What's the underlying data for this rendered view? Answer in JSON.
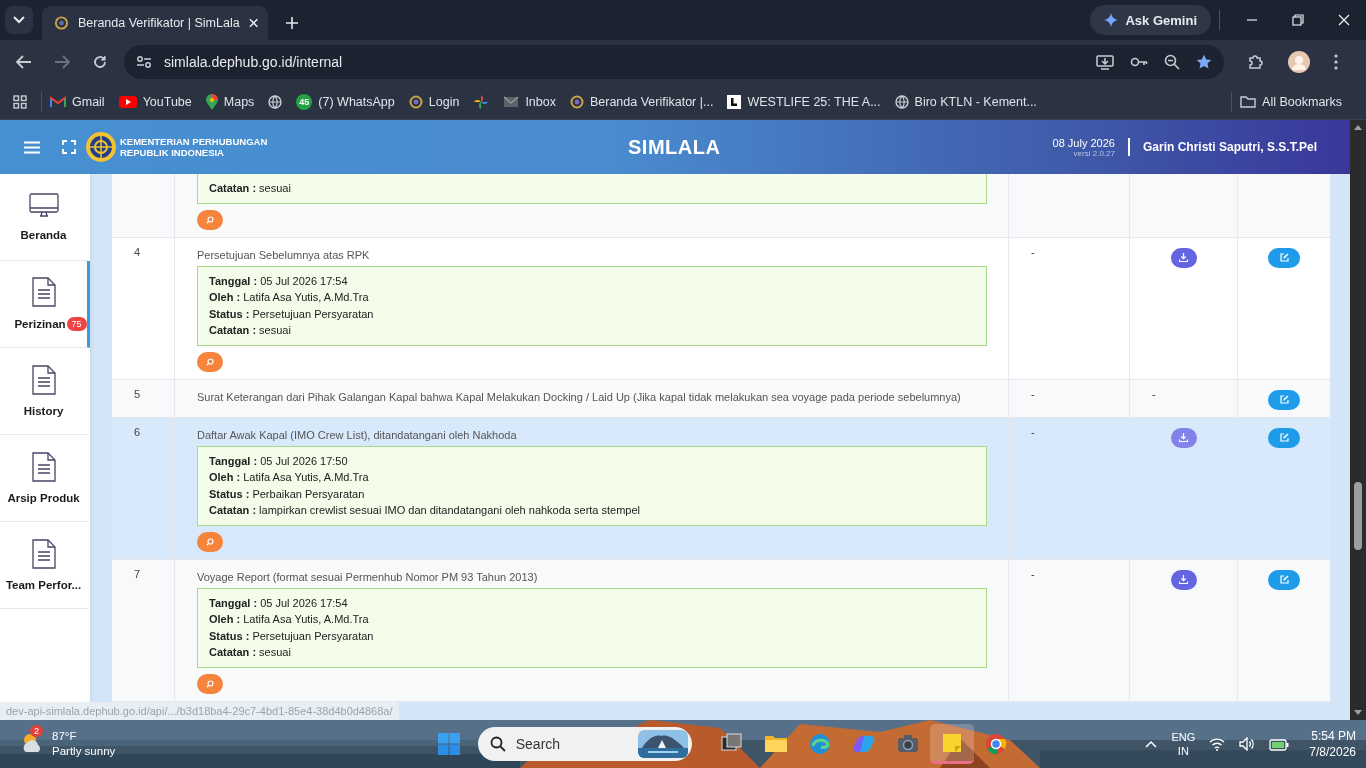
{
  "browser": {
    "tabs": [
      {
        "title": "Beranda Verifikator | SimLala",
        "selected": true
      }
    ],
    "ask_gemini": "Ask Gemini",
    "url": "simlala.dephub.go.id/internal",
    "bookmarks": [
      {
        "kind": "gmail",
        "label": "Gmail"
      },
      {
        "kind": "youtube",
        "label": "YouTube"
      },
      {
        "kind": "maps",
        "label": "Maps"
      },
      {
        "kind": "globe"
      },
      {
        "kind": "whatsapp",
        "label": "(7) WhatsApp",
        "badge": "45"
      },
      {
        "kind": "wheel",
        "label": "Login"
      },
      {
        "kind": "pinwheel"
      },
      {
        "kind": "mail",
        "label": "Inbox"
      },
      {
        "kind": "wheel",
        "label": "Beranda Verifikator |..."
      },
      {
        "kind": "square",
        "label": "WESTLIFE 25: THE A..."
      },
      {
        "kind": "globe",
        "label": "Biro KTLN - Kement..."
      }
    ],
    "all_bookmarks": "All Bookmarks"
  },
  "header": {
    "org_line1": "KEMENTERIAN PERHUBUNGAN",
    "org_line2": "REPUBLIK INDONESIA",
    "app_title": "SIMLALA",
    "date": "08 July 2026",
    "version": "versi 2.0.27",
    "user": "Garin Christi Saputri, S.S.T.Pel"
  },
  "sidebar": {
    "items": [
      {
        "kind": "monitor",
        "label": "Beranda",
        "selected": false
      },
      {
        "kind": "document",
        "label": "Perizinan",
        "selected": true,
        "badge": "75"
      },
      {
        "kind": "document",
        "label": "History",
        "selected": false
      },
      {
        "kind": "document",
        "label": "Arsip Produk",
        "selected": false
      },
      {
        "kind": "document",
        "label": "Team Perfor...",
        "selected": false
      }
    ]
  },
  "table": {
    "rows": [
      {
        "number": "",
        "title": "",
        "hovered": false,
        "remarks": [
          "**Catatan :** sesuai"
        ],
        "column_3": "",
        "column_4": {
          "kind": "none"
        },
        "edit": false
      },
      {
        "number": "4",
        "title": "Persetujuan Sebelumnya atas RPK",
        "hovered": false,
        "remarks": [
          "**Tanggal :** 05 Jul 2026 17:54",
          "**Oleh :** Latifa Asa Yutis, A.Md.Tra",
          "**Status :** Persetujuan Persyaratan",
          "**Catatan :** sesuai"
        ],
        "column_3": "-",
        "column_4": {
          "kind": "download"
        },
        "edit": true
      },
      {
        "number": "5",
        "title": "Surat Keterangan dari Pihak Galangan Kapal bahwa Kapal Melakukan Docking / Laid Up (Jika kapal tidak melakukan sea voyage pada periode sebelumnya)",
        "hovered": false,
        "remarks": [],
        "column_3": "-",
        "column_4": {
          "kind": "text",
          "text": "-"
        },
        "edit": true
      },
      {
        "number": "6",
        "title": "Daftar Awak Kapal (IMO Crew List), ditandatangani oleh Nakhoda",
        "hovered": true,
        "remarks": [
          "**Tanggal :** 05 Jul 2026 17:50",
          "**Oleh :** Latifa Asa Yutis, A.Md.Tra",
          "**Status :** Perbaikan Persyaratan",
          "**Catatan :** lampirkan crewlist sesuai IMO dan ditandatangani oleh nahkoda serta stempel"
        ],
        "column_3": "-",
        "column_4": {
          "kind": "download"
        },
        "edit": true
      },
      {
        "number": "7",
        "title": "Voyage Report (format sesuai Permenhub Nomor PM 93 Tahun 2013)",
        "hovered": false,
        "remarks": [
          "**Tanggal :** 05 Jul 2026 17:54",
          "**Oleh :** Latifa Asa Yutis, A.Md.Tra",
          "**Status :** Persetujuan Persyaratan",
          "**Catatan :** sesuai"
        ],
        "column_3": "-",
        "column_4": {
          "kind": "download"
        },
        "edit": true
      }
    ]
  },
  "status_url": "dev-api-simlala.dephub.go.id/api/.../b3d18ba4-29c7-4bd1-85e4-38d4b0d4868a/",
  "taskbar": {
    "weather": {
      "badge": "2",
      "temperature": "87°F",
      "condition": "Partly sunny"
    },
    "search_placeholder": "Search",
    "language": "ENG",
    "region": "IN",
    "time": "5:54 PM",
    "date": "7/8/2026",
    "apps": [
      {
        "selected": false
      },
      {
        "selected": false
      },
      {
        "selected": false
      },
      {
        "selected": false
      },
      {
        "selected": false
      },
      {
        "selected": true
      },
      {
        "selected": false
      }
    ]
  }
}
